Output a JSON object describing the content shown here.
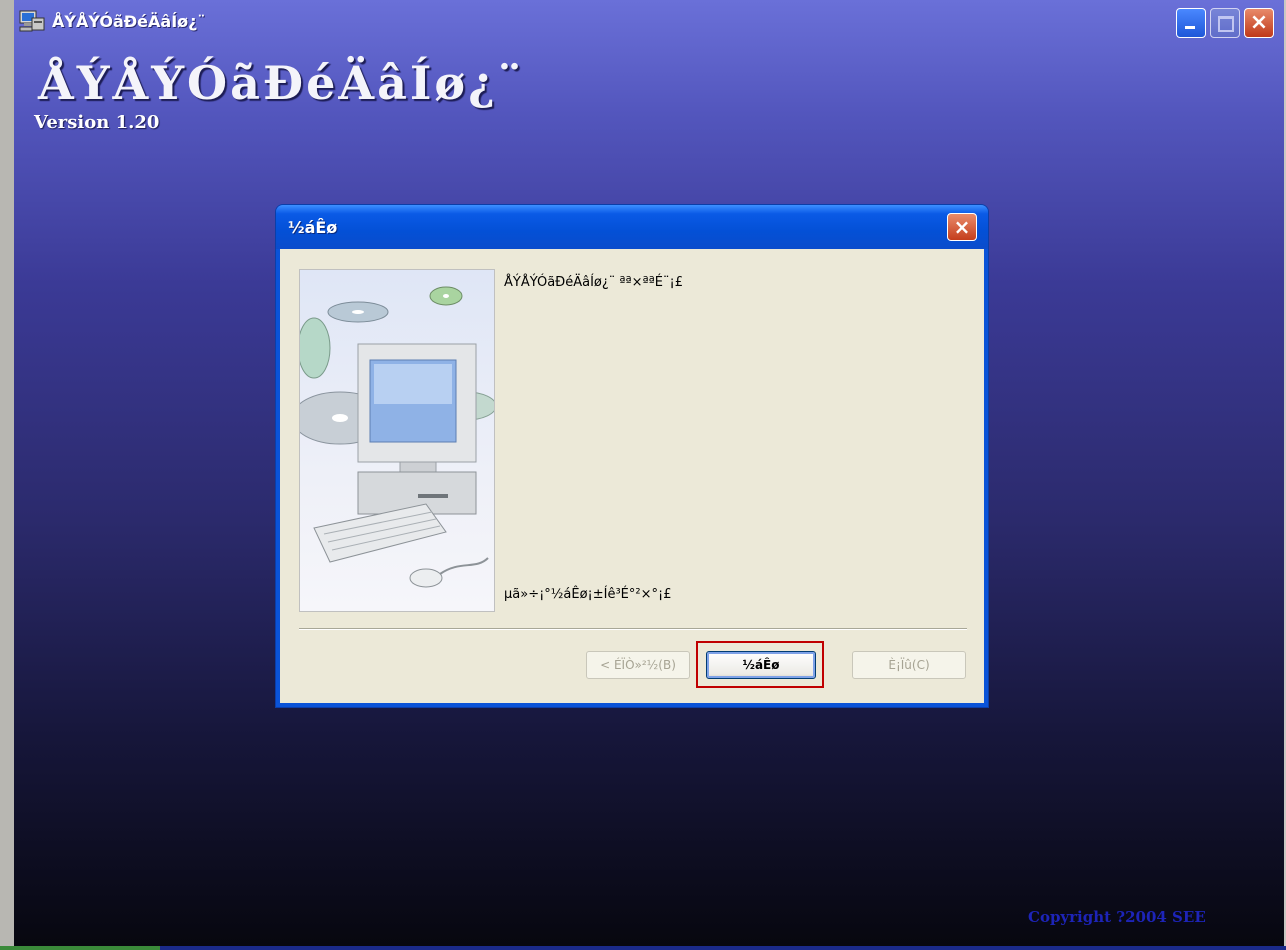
{
  "window": {
    "title": "ÅÝÅÝÓãÐéÄâÍø¿¨",
    "heading": "ÅÝÅÝÓãÐéÄâÍø¿¨",
    "version": "Version 1.20",
    "copyright": "Copyright ?2004 SEE",
    "controls": {
      "minimize": "minimize",
      "maximize": "maximize",
      "close": "×"
    }
  },
  "dialog": {
    "title": "½áÊø",
    "close_label": "×",
    "message_top": "ÅÝÅÝÓãÐéÄâÍø¿¨ ªª×ªªÉ¨¡£",
    "message_bottom": "µã»÷¡°½áÊø¡±Íê³É°²×°¡£",
    "buttons": {
      "back": "< ÉÏÒ»²½(B)",
      "finish": "½áÊø",
      "cancel": "È¡Ïû(C)"
    },
    "button_state": {
      "back": "disabled",
      "finish": "default",
      "cancel": "disabled"
    }
  },
  "annotation": {
    "highlight_color": "#c00000",
    "target": "finish"
  },
  "colors": {
    "titlebar_blue": "#0a53d8",
    "dialog_body": "#ece9d8",
    "background_top": "#6a70d8",
    "background_bottom": "#07070f"
  }
}
